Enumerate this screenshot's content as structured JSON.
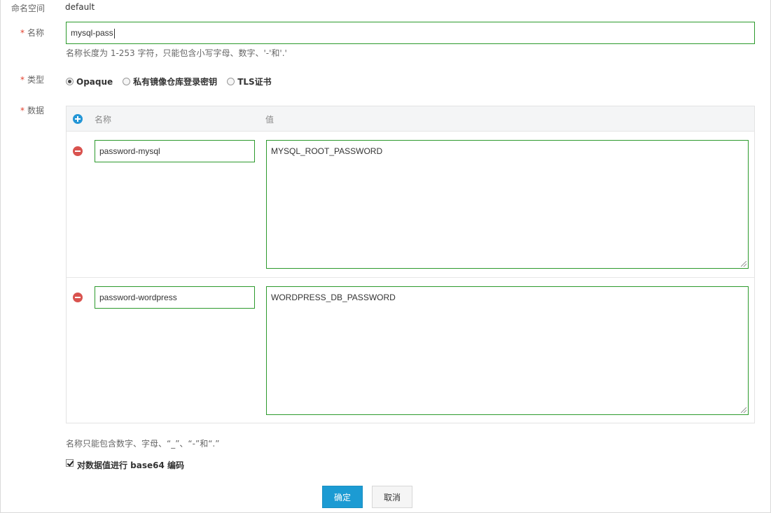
{
  "namespace": {
    "label": "命名空间",
    "value": "default"
  },
  "name": {
    "required_mark": "*",
    "label": "名称",
    "value": "mysql-pass",
    "hint": "名称长度为 1-253 字符，只能包含小写字母、数字、'-'和'.'"
  },
  "type": {
    "required_mark": "*",
    "label": "类型",
    "options": [
      {
        "label": "Opaque",
        "checked": true
      },
      {
        "label": "私有镜像仓库登录密钥",
        "checked": false
      },
      {
        "label": "TLS证书",
        "checked": false
      }
    ]
  },
  "data": {
    "required_mark": "*",
    "label": "数据",
    "col_name": "名称",
    "col_value": "值",
    "rows": [
      {
        "key": "password-mysql",
        "value": "MYSQL_ROOT_PASSWORD"
      },
      {
        "key": "password-wordpress",
        "value": "WORDPRESS_DB_PASSWORD"
      }
    ],
    "note": "名称只能包含数字、字母、“_”、“-”和“.”"
  },
  "encode": {
    "label": "对数据值进行 base64 编码",
    "checked": true
  },
  "actions": {
    "confirm": "确定",
    "cancel": "取消"
  },
  "colors": {
    "accent": "#1c9bd3",
    "input_border": "#2c9a2c",
    "required": "#e2402d",
    "remove": "#d9534f",
    "add": "#2496d6"
  },
  "icons": {
    "add": "plus-circle-icon",
    "remove": "minus-circle-icon"
  }
}
